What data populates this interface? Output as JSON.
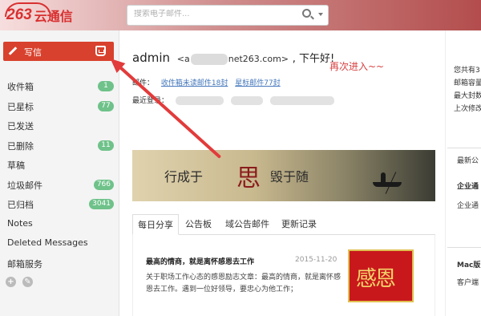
{
  "header": {
    "logo_number": "263",
    "logo_text": "云通信",
    "search_placeholder": "搜索电子邮件..."
  },
  "sidebar": {
    "compose_label": "写信",
    "items": [
      {
        "label": "收件箱",
        "badge": "1"
      },
      {
        "label": "已星标",
        "badge": "77"
      },
      {
        "label": "已发送",
        "badge": ""
      },
      {
        "label": "已删除",
        "badge": "11"
      },
      {
        "label": "草稿",
        "badge": ""
      },
      {
        "label": "垃圾邮件",
        "badge": "766"
      },
      {
        "label": "已归档",
        "badge": "3041"
      },
      {
        "label": "Notes",
        "badge": ""
      },
      {
        "label": "Deleted Messages",
        "badge": ""
      },
      {
        "label": "邮箱服务",
        "badge": ""
      }
    ]
  },
  "main": {
    "greeting_user": "admin",
    "greeting_email_prefix": "<a",
    "greeting_email_suffix": "net263.com>",
    "greeting_hello": ", 下午好!",
    "annotation": "再次进入~~",
    "mail_label": "邮件：",
    "unread_link": "收件箱未读邮件18封",
    "starred_link": "星标邮件77封",
    "last_login_label": "最近登录：",
    "banner_left": "行成于",
    "banner_seal": "思",
    "banner_right": "毁于随",
    "tabs": [
      "每日分享",
      "公告板",
      "域公告邮件",
      "更新记录"
    ],
    "news": {
      "title": "最高的情商，就是离怀感恩去工作",
      "date": "2015-11-20",
      "body": "关于职场工作心态的感恩励志文章：最高的情商，就是离怀感恩去工作。遇到一位好领导，要忠心为他工作；",
      "image_text": "感恩"
    }
  },
  "right_panel": {
    "top_lines": [
      "您共有3",
      "邮箱容量",
      "最大封数",
      "上次修改"
    ],
    "section1_title": "最新公",
    "section1_lines": [
      "企业通",
      "企业通"
    ],
    "section2_title": "Mac版",
    "section2_line": "客户端"
  },
  "colors": {
    "brand_red": "#d8412d",
    "badge_green": "#6fc28a",
    "link_blue": "#4477bb",
    "annotation_red": "#e23b3b"
  }
}
